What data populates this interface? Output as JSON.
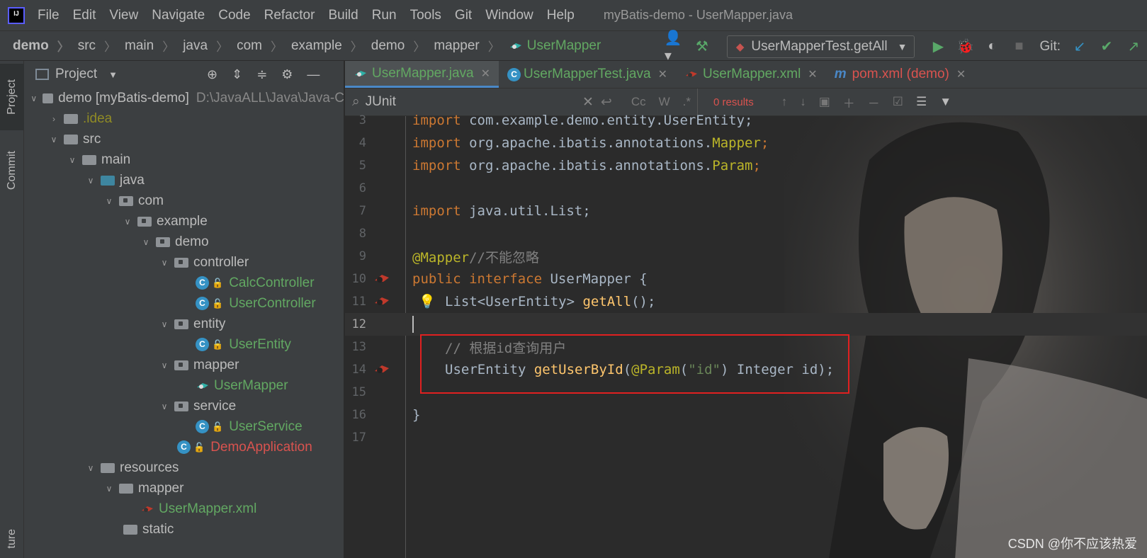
{
  "menubar": {
    "items": [
      "File",
      "Edit",
      "View",
      "Navigate",
      "Code",
      "Refactor",
      "Build",
      "Run",
      "Tools",
      "Git",
      "Window",
      "Help"
    ],
    "window_title": "myBatis-demo - UserMapper.java"
  },
  "breadcrumbs": [
    "demo",
    "src",
    "main",
    "java",
    "com",
    "example",
    "demo",
    "mapper",
    "UserMapper"
  ],
  "toolbar": {
    "run_config": "UserMapperTest.getAll",
    "git_label": "Git:"
  },
  "left_strip": {
    "project": "Project",
    "commit": "Commit",
    "structure": "ture"
  },
  "project_panel": {
    "title": "Project",
    "tree": [
      {
        "label": "demo [myBatis-demo]",
        "path": "D:\\JavaALL\\Java\\Java-C"
      },
      {
        "label": ".idea"
      },
      {
        "label": "src"
      },
      {
        "label": "main"
      },
      {
        "label": "java"
      },
      {
        "label": "com"
      },
      {
        "label": "example"
      },
      {
        "label": "demo"
      },
      {
        "label": "controller"
      },
      {
        "label": "CalcController"
      },
      {
        "label": "UserController"
      },
      {
        "label": "entity"
      },
      {
        "label": "UserEntity"
      },
      {
        "label": "mapper"
      },
      {
        "label": "UserMapper"
      },
      {
        "label": "service"
      },
      {
        "label": "UserService"
      },
      {
        "label": "DemoApplication"
      },
      {
        "label": "resources"
      },
      {
        "label": "mapper"
      },
      {
        "label": "UserMapper.xml"
      },
      {
        "label": "static"
      }
    ]
  },
  "tabs": [
    {
      "label": "UserMapper.java"
    },
    {
      "label": "UserMapperTest.java"
    },
    {
      "label": "UserMapper.xml"
    },
    {
      "label": "pom.xml (demo)"
    }
  ],
  "find": {
    "value": "JUnit",
    "results": "0 results",
    "cc": "Cc",
    "w": "W",
    "regex": ".*"
  },
  "line_numbers": [
    "3",
    "4",
    "5",
    "6",
    "7",
    "8",
    "9",
    "10",
    "11",
    "12",
    "13",
    "14",
    "15",
    "16",
    "17"
  ],
  "code": {
    "l3a": "import",
    "l3b": " com.example.demo.entity.UserEntity;",
    "l4a": "import",
    "l4b": " org.apache.ibatis.annotations.",
    "l4c": "Mapper",
    "l4d": ";",
    "l5a": "import",
    "l5b": " org.apache.ibatis.annotations.",
    "l5c": "Param",
    "l5d": ";",
    "l7a": "import",
    "l7b": " java.util.List;",
    "l9a": "@Mapper",
    "l9b": "//不能忽略",
    "l10a": "public interface",
    "l10b": " UserMapper {",
    "l11a": "List<UserEntity> ",
    "l11b": "getAll",
    "l11c": "();",
    "l13": "// 根据id查询用户",
    "l14a": "UserEntity ",
    "l14b": "getUserById",
    "l14c": "(",
    "l14d": "@Param",
    "l14e": "(",
    "l14f": "\"id\"",
    "l14g": ") Integer id);",
    "l16": "}"
  },
  "watermark": "CSDN @你不应该热爱"
}
